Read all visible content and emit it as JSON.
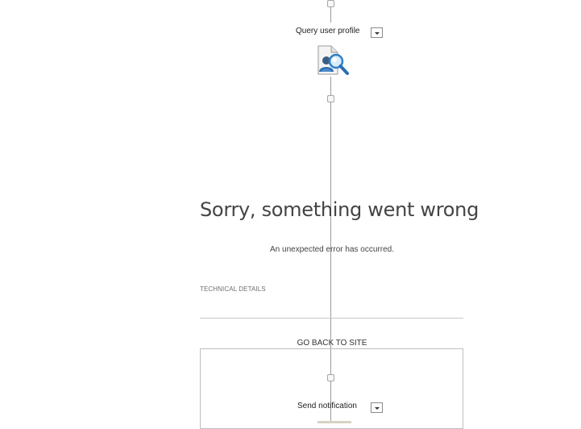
{
  "workflow": {
    "steps": [
      {
        "label": "Query user profile",
        "icon": "user-search-icon"
      },
      {
        "label": "Send notification",
        "icon": "notification-icon"
      }
    ]
  },
  "error": {
    "title": "Sorry, something went wrong",
    "message": "An unexpected error has occurred.",
    "technical_details_label": "TECHNICAL DETAILS",
    "go_back_label": "GO BACK TO SITE"
  },
  "colors": {
    "connector": "#9b9b9b",
    "icon_blue": "#2f7fc4",
    "text": "#444444"
  }
}
